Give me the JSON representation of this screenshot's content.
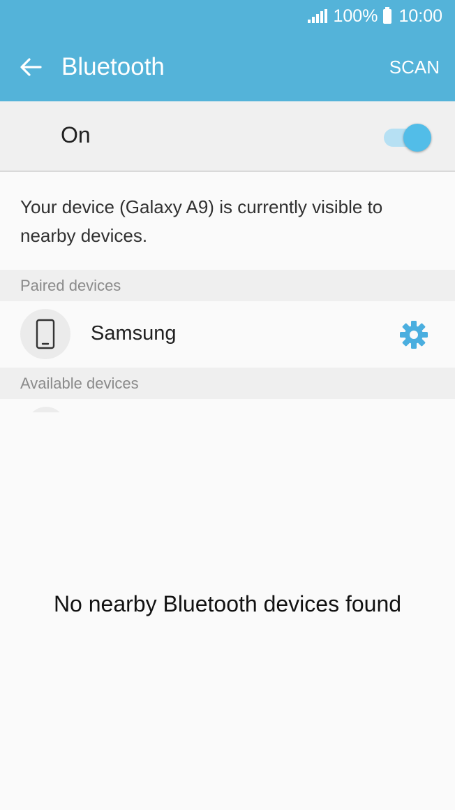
{
  "status_bar": {
    "battery_percent": "100%",
    "time": "10:00",
    "signal_icon": "signal-bars-icon",
    "battery_icon": "battery-full-icon"
  },
  "header": {
    "title": "Bluetooth",
    "back_icon": "arrow-left-icon",
    "scan_label": "SCAN",
    "color": "#54b3d9"
  },
  "toggle": {
    "label": "On",
    "state": true,
    "accent": "#52bde8"
  },
  "visibility_message": "Your device (Galaxy A9) is currently visible to nearby devices.",
  "paired": {
    "section_label": "Paired devices",
    "devices": [
      {
        "name": "Samsung",
        "icon": "phone-icon",
        "settings_icon": "gear-icon"
      }
    ]
  },
  "available": {
    "section_label": "Available devices",
    "empty_message": "No nearby Bluetooth devices found"
  }
}
